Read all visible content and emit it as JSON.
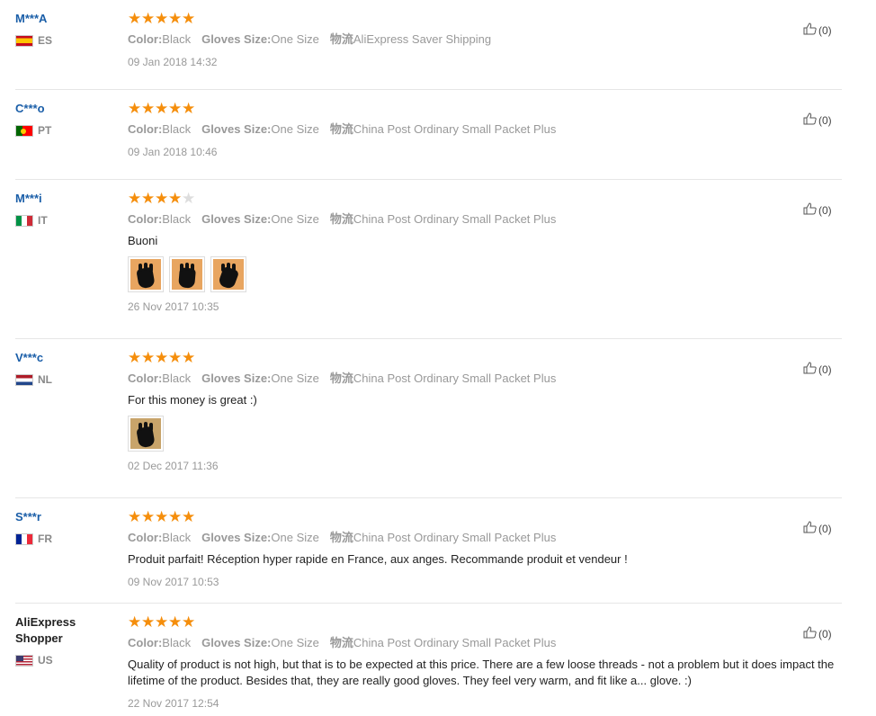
{
  "labels": {
    "color": "Color:",
    "size": "Gloves Size:",
    "logistics": "物流"
  },
  "reviews": [
    {
      "user": "M***A",
      "plain": false,
      "country": "ES",
      "flag": "es",
      "stars": 5,
      "color": "Black",
      "size": "One Size",
      "shipping": "AliExpress Saver Shipping",
      "content": "",
      "images": [],
      "date": "09 Jan 2018 14:32",
      "likes": "(0)"
    },
    {
      "user": "C***o",
      "plain": false,
      "country": "PT",
      "flag": "pt",
      "stars": 5,
      "color": "Black",
      "size": "One Size",
      "shipping": "China Post Ordinary Small Packet Plus",
      "content": "",
      "images": [],
      "date": "09 Jan 2018 10:46",
      "likes": "(0)"
    },
    {
      "user": "M***i",
      "plain": false,
      "country": "IT",
      "flag": "it",
      "stars": 4,
      "color": "Black",
      "size": "One Size",
      "shipping": "China Post Ordinary Small Packet Plus",
      "content": "Buoni",
      "images": [
        "glove-photo-1",
        "glove-photo-2",
        "glove-photo-3"
      ],
      "date": "26 Nov 2017 10:35",
      "likes": "(0)"
    },
    {
      "user": "V***c",
      "plain": false,
      "country": "NL",
      "flag": "nl",
      "stars": 5,
      "color": "Black",
      "size": "One Size",
      "shipping": "China Post Ordinary Small Packet Plus",
      "content": "For this money is great :)",
      "images": [
        "glove-photo-4"
      ],
      "date": "02 Dec 2017 11:36",
      "likes": "(0)"
    },
    {
      "user": "S***r",
      "plain": false,
      "country": "FR",
      "flag": "fr",
      "stars": 5,
      "color": "Black",
      "size": "One Size",
      "shipping": "China Post Ordinary Small Packet Plus",
      "content": "Produit parfait! Réception hyper rapide en France, aux anges. Recommande produit et vendeur !",
      "images": [],
      "date": "09 Nov 2017 10:53",
      "likes": "(0)"
    },
    {
      "user": "AliExpress Shopper",
      "plain": true,
      "country": "US",
      "flag": "us",
      "stars": 5,
      "color": "Black",
      "size": "One Size",
      "shipping": "China Post Ordinary Small Packet Plus",
      "content": "Quality of product is not high, but that is to be expected at this price. There are a few loose threads - not a problem but it does impact the lifetime of the product. Besides that, they are really good gloves. They feel very warm, and fit like a... glove. :)",
      "images": [],
      "date": "22 Nov 2017 12:54",
      "likes": "(0)"
    }
  ],
  "colors": {
    "star": "#f58e0c",
    "username": "#1a5ea8"
  }
}
